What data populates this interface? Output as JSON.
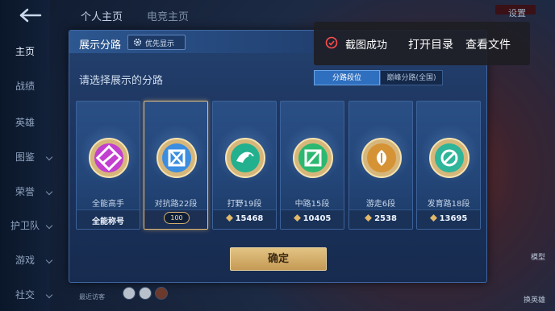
{
  "sidebar": {
    "items": [
      {
        "label": "主页",
        "active": true
      },
      {
        "label": "战绩"
      },
      {
        "label": "英雄"
      },
      {
        "label": "图鉴",
        "chevron": true
      },
      {
        "label": "荣誉",
        "chevron": true
      },
      {
        "label": "护卫队",
        "chevron": true
      },
      {
        "label": "游戏",
        "chevron": true
      },
      {
        "label": "社交",
        "chevron": true
      }
    ]
  },
  "topbar": {
    "tab_profile": "个人主页",
    "tab_second": "电竞主页",
    "settings": "设置"
  },
  "dialog": {
    "title": "展示分路",
    "priority_label": "优先显示",
    "subtitle": "请选择展示的分路",
    "seg_on": "分路段位",
    "seg_off": "巅峰分路(全国)",
    "confirm_label": "确定",
    "cards": [
      {
        "name": "全能高手",
        "footer": "全能称号",
        "emblem": "purple-emblem-icon",
        "color": "#c23fd0"
      },
      {
        "name": "对抗路22段",
        "footer": "100",
        "emblem": "sword-emblem-icon",
        "color": "#3a8de0",
        "selected": true
      },
      {
        "name": "打野19段",
        "footer": "15468",
        "emblem": "dragon-emblem-icon",
        "color": "#23b08e"
      },
      {
        "name": "中路15段",
        "footer": "10405",
        "emblem": "slash-emblem-icon",
        "color": "#2cb870"
      },
      {
        "name": "游走6段",
        "footer": "2538",
        "emblem": "wing-emblem-icon",
        "color": "#d69336"
      },
      {
        "name": "发育路18段",
        "footer": "13695",
        "emblem": "target-emblem-icon",
        "color": "#2eb59a"
      }
    ]
  },
  "toast": {
    "message": "截图成功",
    "open_dir": "打开目录",
    "view_file": "查看文件"
  },
  "bottombar": {
    "recent_visitors": "最近访客",
    "right1": "模型",
    "right2": "换英雄"
  }
}
